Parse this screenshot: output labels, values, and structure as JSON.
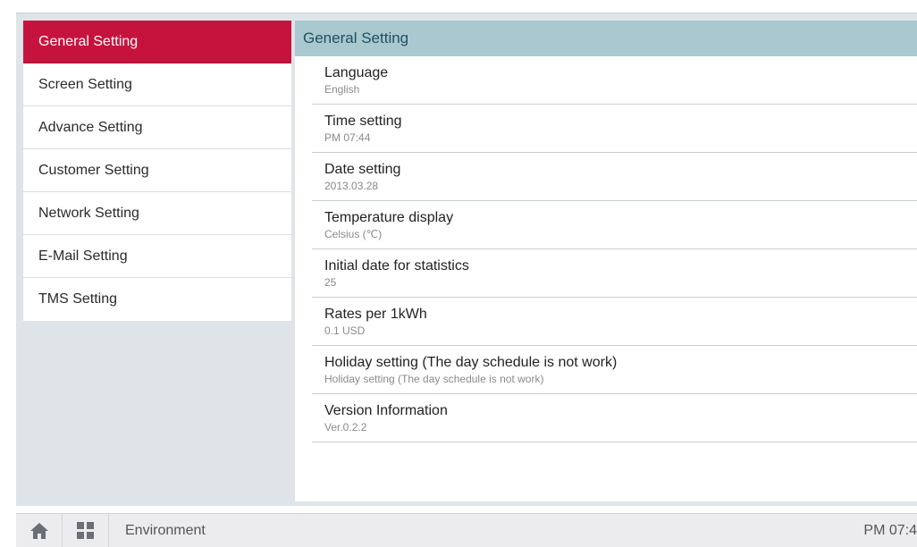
{
  "sidebar": {
    "items": [
      {
        "label": "General Setting",
        "active": true
      },
      {
        "label": "Screen Setting"
      },
      {
        "label": "Advance Setting"
      },
      {
        "label": "Customer Setting"
      },
      {
        "label": "Network Setting"
      },
      {
        "label": "E-Mail Setting"
      },
      {
        "label": "TMS Setting"
      }
    ]
  },
  "main": {
    "header": "General Setting",
    "settings": [
      {
        "title": "Language",
        "value": "English"
      },
      {
        "title": "Time setting",
        "value": "PM 07:44"
      },
      {
        "title": "Date setting",
        "value": "2013.03.28"
      },
      {
        "title": "Temperature display",
        "value": "Celsius (℃)"
      },
      {
        "title": "Initial date for statistics",
        "value": "25"
      },
      {
        "title": "Rates per 1kWh",
        "value": "0.1 USD"
      },
      {
        "title": "Holiday setting (The day schedule is not work)",
        "value": "Holiday setting (The day schedule is not work)"
      },
      {
        "title": "Version Information",
        "value": "Ver.0.2.2"
      }
    ]
  },
  "bottombar": {
    "label": "Environment",
    "time": "PM 07:4"
  },
  "icons": {
    "home": "home-icon",
    "grid": "grid-menu-icon"
  },
  "colors": {
    "accent": "#c5133d",
    "header_bg": "#a9c8cf",
    "header_text": "#1f4f61"
  }
}
